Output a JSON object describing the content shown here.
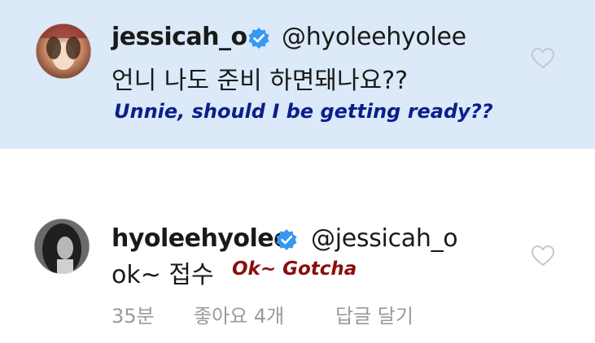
{
  "comments": [
    {
      "username": "jessicah_o",
      "mention": "@hyoleehyolee",
      "text": "언니 나도 준비 하면돼나요??",
      "translation": "Unnie, should I be getting ready??",
      "translation_color": "#0b1f8a",
      "background": "#dbe9f8"
    },
    {
      "username": "hyoleehyolee",
      "mention": "@jessicah_o",
      "text": "ok~ 접수",
      "translation": "Ok~ Gotcha",
      "translation_color": "#8b0d0d",
      "time": "35분",
      "likes": "좋아요 4개",
      "reply": "답글 달기"
    }
  ],
  "colors": {
    "verified_badge": "#3897f0",
    "heart_outline": "#c8c8c8"
  },
  "icons": [
    "verified-badge-icon",
    "heart-icon"
  ]
}
